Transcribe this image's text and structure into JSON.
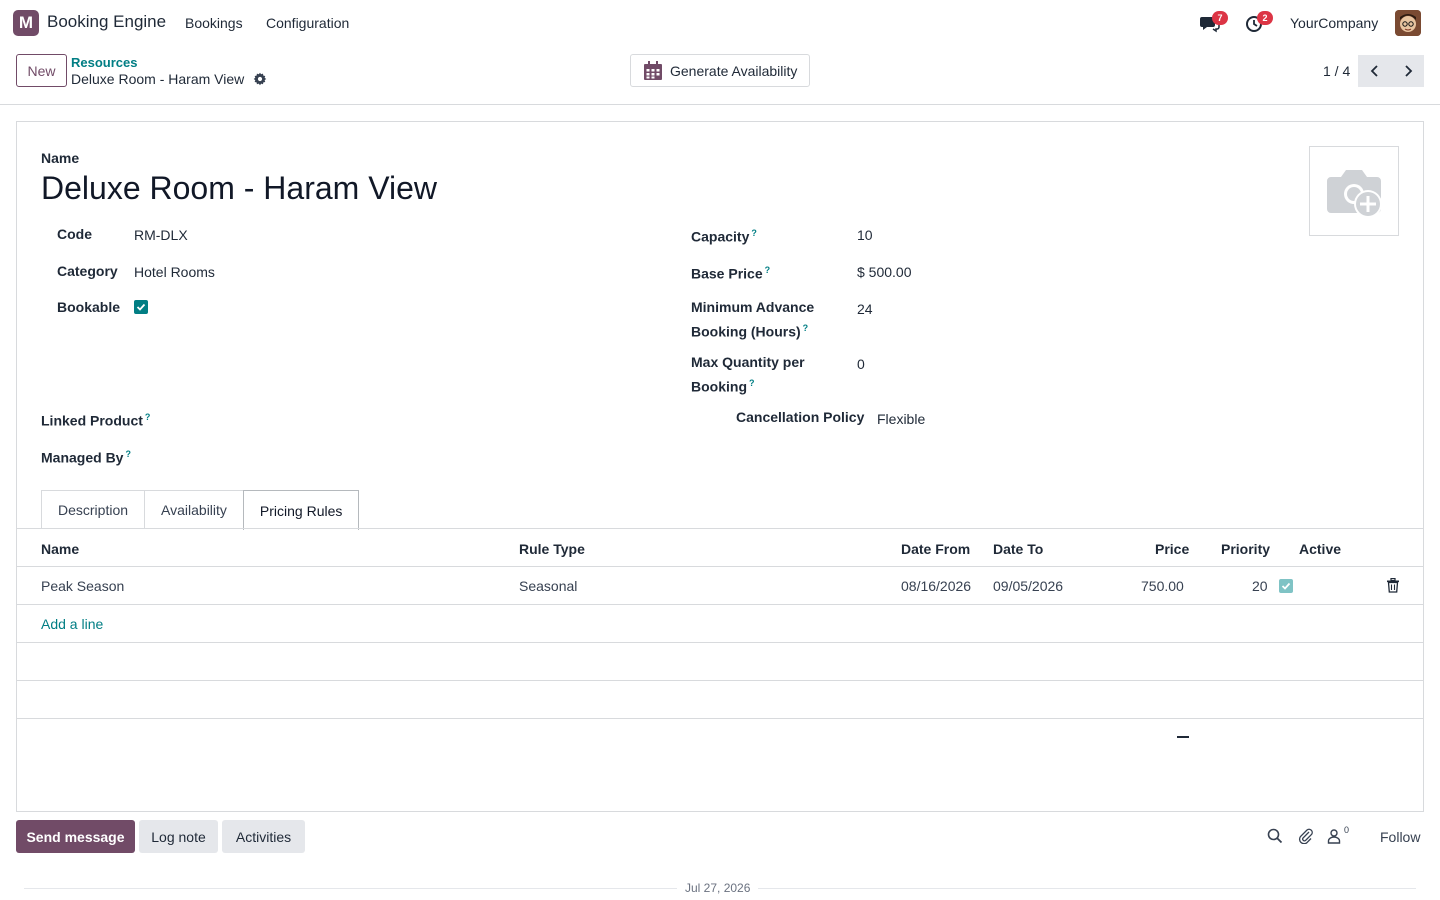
{
  "navbar": {
    "app_logo_letter": "M",
    "app_title": "Booking Engine",
    "menus": [
      "Bookings",
      "Configuration"
    ],
    "messages_badge": "7",
    "activities_badge": "2",
    "company": "YourCompany"
  },
  "control_panel": {
    "new_label": "New",
    "breadcrumb_parent": "Resources",
    "breadcrumb_current": "Deluxe Room - Haram View",
    "generate_label": "Generate Availability",
    "pager": "1 / 4"
  },
  "form": {
    "name_label": "Name",
    "title": "Deluxe Room - Haram View",
    "left_fields": {
      "code_label": "Code",
      "code_value": "RM-DLX",
      "category_label": "Category",
      "category_value": "Hotel Rooms",
      "bookable_label": "Bookable",
      "bookable_checked": true
    },
    "right_fields": {
      "capacity_label": "Capacity",
      "capacity_value": "10",
      "base_price_label": "Base Price",
      "base_price_value": "$ 500.00",
      "min_advance_label_1": "Minimum Advance",
      "min_advance_label_2": "Booking (Hours)",
      "min_advance_value": "24",
      "max_qty_label_1": "Max Quantity per",
      "max_qty_label_2": "Booking",
      "max_qty_value": "0"
    },
    "linked_product_label": "Linked Product",
    "managed_by_label": "Managed By",
    "cancellation_label": "Cancellation Policy",
    "cancellation_value": "Flexible",
    "help_marker": "?"
  },
  "tabs": [
    "Description",
    "Availability",
    "Pricing Rules"
  ],
  "active_tab": "Pricing Rules",
  "pricing_table": {
    "columns": [
      "Name",
      "Rule Type",
      "Date From",
      "Date To",
      "Price",
      "Priority",
      "Active"
    ],
    "rows": [
      {
        "name": "Peak Season",
        "rule_type": "Seasonal",
        "date_from": "08/16/2026",
        "date_to": "09/05/2026",
        "price": "750.00",
        "priority": "20",
        "active": true
      }
    ],
    "add_line_label": "Add a line"
  },
  "chatter": {
    "send_message": "Send message",
    "log_note": "Log note",
    "activities": "Activities",
    "followers_count": "0",
    "follow_label": "Follow",
    "date_separator": "Jul 27, 2026"
  },
  "colors": {
    "brand": "#714B67",
    "accent": "#017e84",
    "badge": "#dc3545"
  }
}
